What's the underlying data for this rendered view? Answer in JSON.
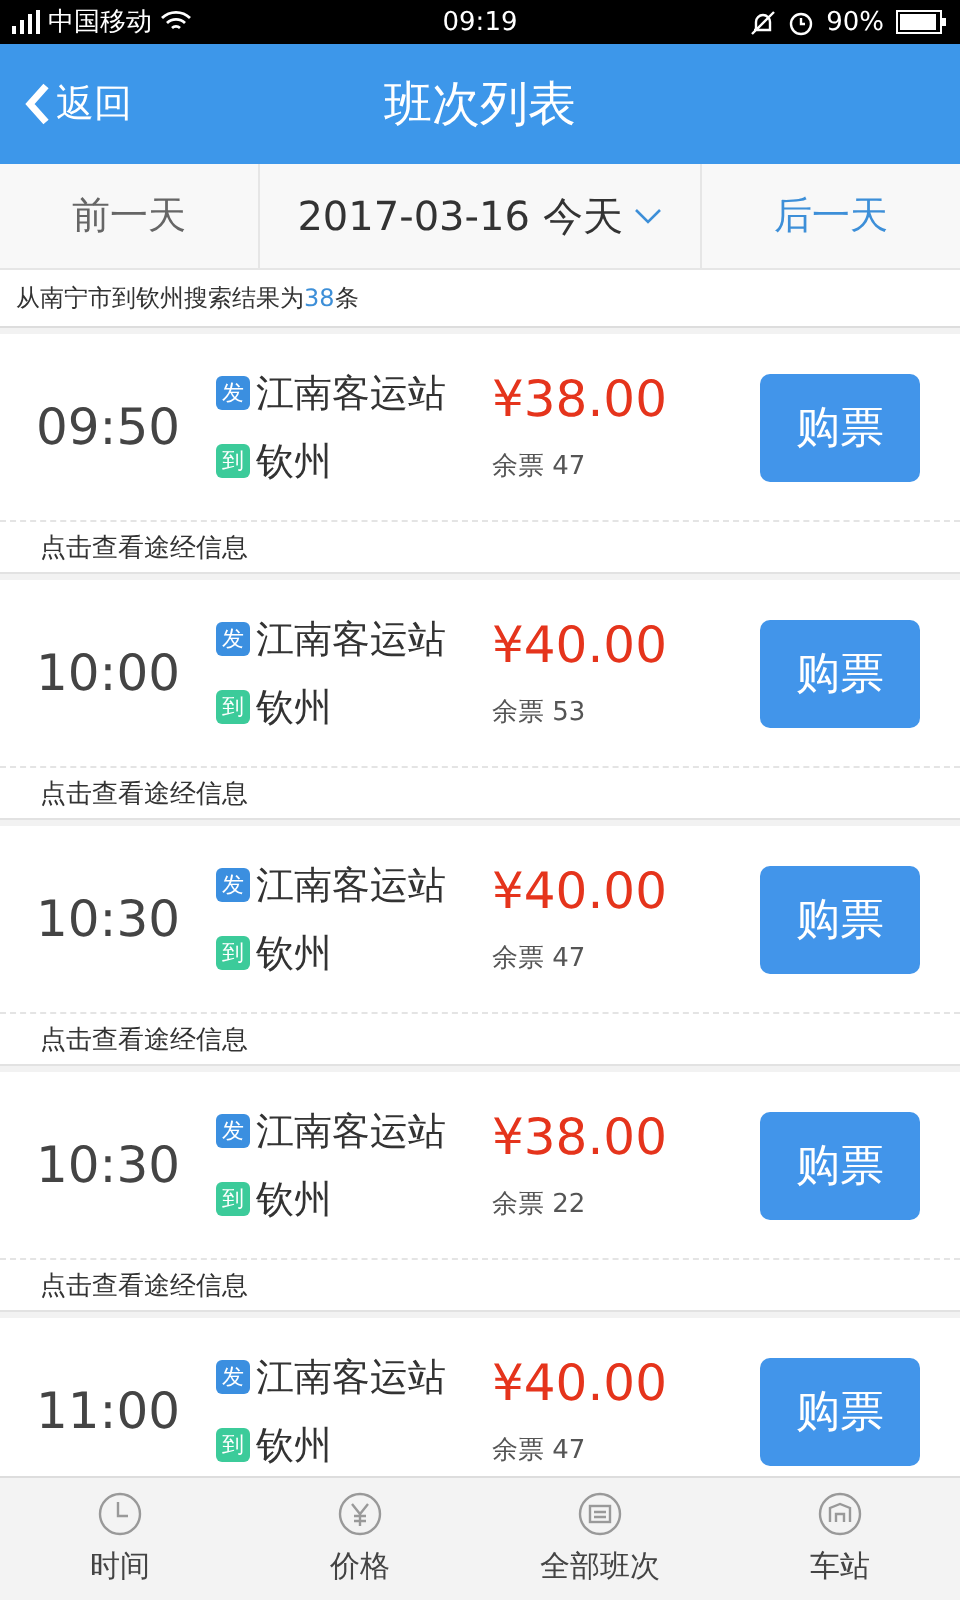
{
  "status_bar": {
    "carrier": "中国移动",
    "time": "09:19",
    "battery": "90%"
  },
  "header": {
    "back": "返回",
    "title": "班次列表"
  },
  "date_bar": {
    "prev": "前一天",
    "date": "2017-03-16 今天",
    "next": "后一天"
  },
  "summary": {
    "text": "从南宁市到钦州搜索结果为",
    "count": "38",
    "suffix": "条"
  },
  "trips": [
    {
      "time": "09:50",
      "from_tag": "发",
      "from": "江南客运站",
      "to_tag": "到",
      "to": "钦州",
      "price": "¥38.00",
      "seats": "余票 47",
      "button": "购票",
      "route_link": "点击查看途经信息"
    },
    {
      "time": "10:00",
      "from_tag": "发",
      "from": "江南客运站",
      "to_tag": "到",
      "to": "钦州",
      "price": "¥40.00",
      "seats": "余票 53",
      "button": "购票",
      "route_link": "点击查看途经信息"
    },
    {
      "time": "10:30",
      "from_tag": "发",
      "from": "江南客运站",
      "to_tag": "到",
      "to": "钦州",
      "price": "¥40.00",
      "seats": "余票 47",
      "button": "购票",
      "route_link": "点击查看途经信息"
    },
    {
      "time": "10:30",
      "from_tag": "发",
      "from": "江南客运站",
      "to_tag": "到",
      "to": "钦州",
      "price": "¥38.00",
      "seats": "余票 22",
      "button": "购票",
      "route_link": "点击查看途经信息"
    },
    {
      "time": "11:00",
      "from_tag": "发",
      "from": "江南客运站",
      "to_tag": "到",
      "to": "钦州",
      "price": "¥40.00",
      "seats": "余票 47",
      "button": "购票"
    }
  ],
  "tab_bar": [
    {
      "kind": "clock",
      "label": "时间"
    },
    {
      "kind": "yen",
      "label": "价格"
    },
    {
      "kind": "list",
      "label": "全部班次"
    },
    {
      "kind": "station",
      "label": "车站"
    }
  ]
}
